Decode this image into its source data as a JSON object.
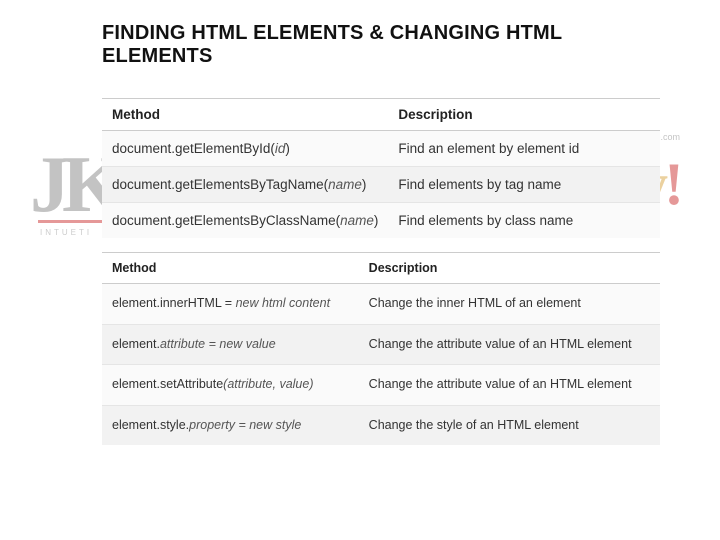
{
  "title": "FINDING HTML ELEMENTS  & CHANGING HTML ELEMENTS",
  "table1": {
    "headers": {
      "method": "Method",
      "description": "Description"
    },
    "rows": [
      {
        "method_pre": "document.getElementById(",
        "method_arg": "id",
        "method_post": ")",
        "description": "Find an element by element id"
      },
      {
        "method_pre": "document.getElementsByTagName(",
        "method_arg": "name",
        "method_post": ")",
        "description": "Find elements by tag name"
      },
      {
        "method_pre": "document.getElementsByClassName(",
        "method_arg": "name",
        "method_post": ")",
        "description": "Find elements by class name"
      }
    ]
  },
  "table2": {
    "headers": {
      "method": "Method",
      "description": "Description"
    },
    "rows": [
      {
        "method_pre": "element.innerHTML =  ",
        "method_arg": "new html content",
        "method_post": "",
        "description": "Change the inner HTML of an element"
      },
      {
        "method_pre": "element.",
        "method_mid": "attribute = new value",
        "method_arg": "",
        "method_post": "",
        "description": "Change the attribute value of an HTML element"
      },
      {
        "method_pre": "element.setAttribute",
        "method_arg": "(attribute, value)",
        "method_post": "",
        "description": "Change the attribute value of an HTML element"
      },
      {
        "method_pre": "element.style.",
        "method_mid": "property = new style",
        "method_arg": "",
        "method_post": "",
        "description": "Change the style of an HTML element"
      }
    ]
  },
  "bg": {
    "left": "JKL",
    "left_sub": "INTUETI",
    "right_pre": "ory",
    "right_ex": "!",
    "right_sub": "s.yolasite.com"
  }
}
